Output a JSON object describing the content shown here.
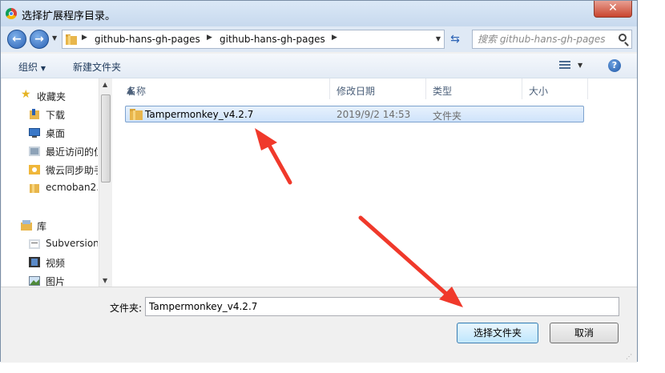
{
  "window": {
    "title": "选择扩展程序目录。",
    "close_label": "✕"
  },
  "address": {
    "crumbs": [
      "github-hans-gh-pages",
      "github-hans-gh-pages"
    ]
  },
  "search": {
    "placeholder": "搜索 github-hans-gh-pages"
  },
  "toolbar": {
    "organize": "组织",
    "new_folder": "新建文件夹"
  },
  "nav": {
    "favorites": {
      "label": "收藏夹",
      "items": [
        "下载",
        "桌面",
        "最近访问的位",
        "微云同步助手",
        "ecmoban2."
      ]
    },
    "libraries": {
      "label": "库",
      "items": [
        "Subversion",
        "视频",
        "图片"
      ]
    }
  },
  "columns": {
    "name": "名称",
    "modified": "修改日期",
    "type": "类型",
    "size": "大小"
  },
  "files": [
    {
      "name": "Tampermonkey_v4.2.7",
      "modified": "2019/9/2 14:53",
      "type": "文件夹",
      "size": ""
    }
  ],
  "footer": {
    "folder_label": "文件夹:",
    "folder_value": "Tampermonkey_v4.2.7",
    "select_button": "选择文件夹",
    "cancel_button": "取消"
  },
  "colors": {
    "accent": "#2b62b5",
    "annotation_arrow": "#f0392b",
    "selection": "#cfe3fb"
  }
}
